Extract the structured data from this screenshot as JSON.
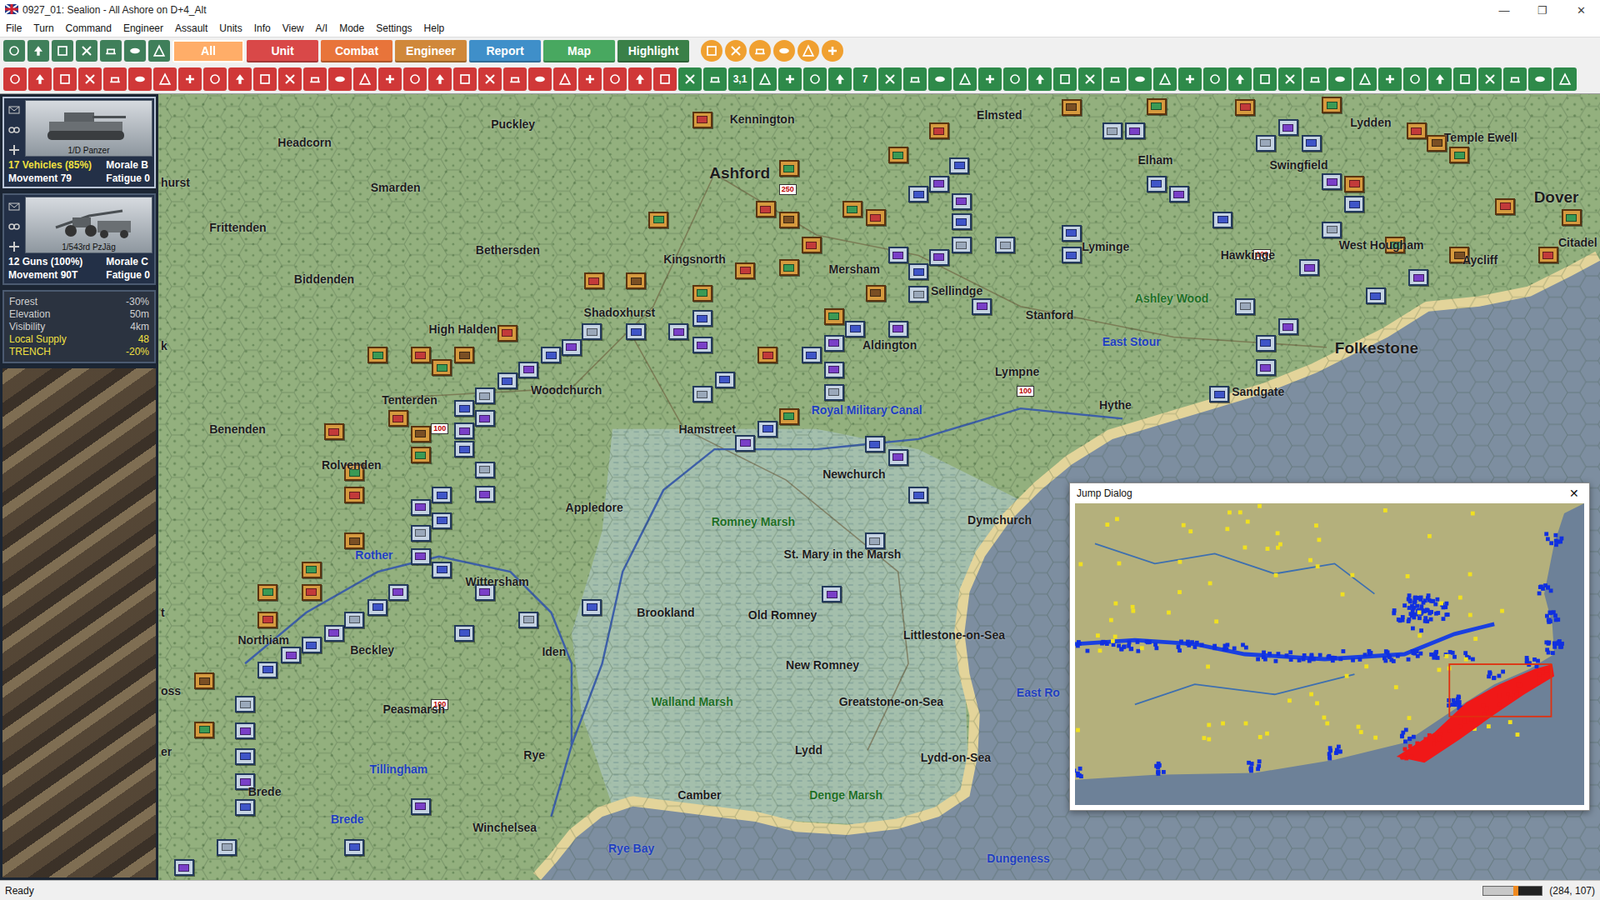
{
  "window": {
    "title": "0927_01: Sealion - All Ashore on D+4_Alt",
    "controls": [
      "—",
      "❐",
      "✕"
    ]
  },
  "menu": [
    "File",
    "Turn",
    "Command",
    "Engineer",
    "Assault",
    "Units",
    "Info",
    "View",
    "A/I",
    "Mode",
    "Settings",
    "Help"
  ],
  "tabs": [
    {
      "label": "All",
      "selected": true,
      "color": "#f0a060"
    },
    {
      "label": "Unit",
      "selected": false,
      "color": "#d94848"
    },
    {
      "label": "Combat",
      "selected": false,
      "color": "#e8743a"
    },
    {
      "label": "Engineer",
      "selected": false,
      "color": "#d0883a"
    },
    {
      "label": "Report",
      "selected": false,
      "color": "#3f8fc9"
    },
    {
      "label": "Map",
      "selected": false,
      "color": "#48a860"
    },
    {
      "label": "Highlight",
      "selected": false,
      "color": "#3a8048"
    }
  ],
  "toolbar2_labels": [
    "3,1",
    "7"
  ],
  "units_panel": [
    {
      "name": "1/D Panzer",
      "strength": "17 Vehicles (85%)",
      "strength_color": "#f0e040",
      "morale": "Morale B",
      "movement": "Movement 79",
      "fatigue": "Fatigue 0",
      "kind": "tank",
      "selected": true
    },
    {
      "name": "1/543rd PzJäg",
      "strength": "12 Guns (100%)",
      "strength_color": "#ffffff",
      "morale": "Morale C",
      "movement": "Movement 90T",
      "fatigue": "Fatigue 0",
      "kind": "gun",
      "selected": false
    }
  ],
  "terrain": [
    {
      "label": "Forest",
      "value": "-30%",
      "highlight": false
    },
    {
      "label": "Elevation",
      "value": "50m",
      "highlight": false
    },
    {
      "label": "Visibility",
      "value": "4km",
      "highlight": false
    },
    {
      "label": "Local Supply",
      "value": "48",
      "highlight": true
    },
    {
      "label": "TRENCH",
      "value": "-20%",
      "highlight": true
    }
  ],
  "map": {
    "places": [
      {
        "name": "Headcorn",
        "kind": "town"
      },
      {
        "name": "Puckley",
        "kind": "town"
      },
      {
        "name": "Kennington",
        "kind": "town"
      },
      {
        "name": "Ashford",
        "kind": "big"
      },
      {
        "name": "Elmsted",
        "kind": "town"
      },
      {
        "name": "Lydden",
        "kind": "town"
      },
      {
        "name": "Temple Ewell",
        "kind": "town"
      },
      {
        "name": "Dover",
        "kind": "big"
      },
      {
        "name": "Elham",
        "kind": "town"
      },
      {
        "name": "Swingfield",
        "kind": "town"
      },
      {
        "name": "Smarden",
        "kind": "town"
      },
      {
        "name": "Frittenden",
        "kind": "town"
      },
      {
        "name": "Bethersden",
        "kind": "town"
      },
      {
        "name": "Kingsnorth",
        "kind": "town"
      },
      {
        "name": "Mersham",
        "kind": "town"
      },
      {
        "name": "Lyminge",
        "kind": "town"
      },
      {
        "name": "Hawkinge",
        "kind": "town"
      },
      {
        "name": "West Hougham",
        "kind": "town"
      },
      {
        "name": "Citadel",
        "kind": "town"
      },
      {
        "name": "Aycliff",
        "kind": "town"
      },
      {
        "name": "Sellindge",
        "kind": "town"
      },
      {
        "name": "Ashley Wood",
        "kind": "region"
      },
      {
        "name": "Biddenden",
        "kind": "town"
      },
      {
        "name": "Shadoxhurst",
        "kind": "town"
      },
      {
        "name": "Aldington",
        "kind": "town"
      },
      {
        "name": "Stanford",
        "kind": "town"
      },
      {
        "name": "East Stour",
        "kind": "water"
      },
      {
        "name": "Folkestone",
        "kind": "big"
      },
      {
        "name": "High Halden",
        "kind": "town"
      },
      {
        "name": "Sandgate",
        "kind": "town"
      },
      {
        "name": "Woodchurch",
        "kind": "town"
      },
      {
        "name": "Lympne",
        "kind": "town"
      },
      {
        "name": "Hythe",
        "kind": "town"
      },
      {
        "name": "Tenterden",
        "kind": "town"
      },
      {
        "name": "Royal Military Canal",
        "kind": "water"
      },
      {
        "name": "Benenden",
        "kind": "town"
      },
      {
        "name": "Hamstreet",
        "kind": "town"
      },
      {
        "name": "Newchurch",
        "kind": "town"
      },
      {
        "name": "Rolvenden",
        "kind": "town"
      },
      {
        "name": "Appledore",
        "kind": "town"
      },
      {
        "name": "Dymchurch",
        "kind": "town"
      },
      {
        "name": "Romney Marsh",
        "kind": "region"
      },
      {
        "name": "Rother",
        "kind": "water"
      },
      {
        "name": "St. Mary in the Marsh",
        "kind": "town"
      },
      {
        "name": "Wittersham",
        "kind": "town"
      },
      {
        "name": "Brookland",
        "kind": "town"
      },
      {
        "name": "Old Romney",
        "kind": "town"
      },
      {
        "name": "Northiam",
        "kind": "town"
      },
      {
        "name": "Littlestone-on-Sea",
        "kind": "town"
      },
      {
        "name": "Beckley",
        "kind": "town"
      },
      {
        "name": "Iden",
        "kind": "town"
      },
      {
        "name": "New Romney",
        "kind": "town"
      },
      {
        "name": "East Ro",
        "kind": "water"
      },
      {
        "name": "Walland Marsh",
        "kind": "region"
      },
      {
        "name": "Greatstone-on-Sea",
        "kind": "town"
      },
      {
        "name": "Peasmarsh",
        "kind": "town"
      },
      {
        "name": "Rye",
        "kind": "town"
      },
      {
        "name": "Lydd",
        "kind": "town"
      },
      {
        "name": "Lydd-on-Sea",
        "kind": "town"
      },
      {
        "name": "Tillingham",
        "kind": "water"
      },
      {
        "name": "Brede",
        "kind": "town"
      },
      {
        "name": "Camber",
        "kind": "town"
      },
      {
        "name": "Denge Marsh",
        "kind": "region"
      },
      {
        "name": "Brede",
        "kind": "water"
      },
      {
        "name": "Winchelsea",
        "kind": "town"
      },
      {
        "name": "Rye Bay",
        "kind": "water"
      },
      {
        "name": "Dungeness",
        "kind": "water"
      },
      {
        "name": "hurst",
        "kind": "town"
      },
      {
        "name": "k",
        "kind": "town"
      },
      {
        "name": "t",
        "kind": "town"
      },
      {
        "name": "oss",
        "kind": "town"
      },
      {
        "name": "er",
        "kind": "town"
      }
    ],
    "markers": [
      {
        "text": "100"
      },
      {
        "text": "100"
      },
      {
        "text": "100"
      },
      {
        "text": "100"
      },
      {
        "text": "250"
      }
    ],
    "units": [
      {
        "side": "axis",
        "color": "#7a3fc8"
      },
      {
        "side": "axis",
        "color": "#3f55c8"
      },
      {
        "side": "axis",
        "color": "#7a3fc8"
      },
      {
        "side": "axis",
        "color": "#3f55c8"
      },
      {
        "side": "axis",
        "color": "#9aa8ba"
      },
      {
        "side": "axis",
        "color": "#7a3fc8"
      },
      {
        "side": "axis",
        "color": "#3f55c8"
      },
      {
        "side": "axis",
        "color": "#7a3fc8"
      },
      {
        "side": "axis",
        "color": "#3f55c8"
      },
      {
        "side": "axis",
        "color": "#9aa8ba"
      },
      {
        "side": "axis",
        "color": "#7a3fc8"
      },
      {
        "side": "axis",
        "color": "#3f55c8"
      },
      {
        "side": "axis",
        "color": "#7a3fc8"
      },
      {
        "side": "axis",
        "color": "#3f55c8"
      },
      {
        "side": "axis",
        "color": "#9aa8ba"
      },
      {
        "side": "axis",
        "color": "#7a3fc8"
      },
      {
        "side": "axis",
        "color": "#3f55c8"
      },
      {
        "side": "axis",
        "color": "#7a3fc8"
      },
      {
        "side": "axis",
        "color": "#3f55c8"
      },
      {
        "side": "axis",
        "color": "#9aa8ba"
      },
      {
        "side": "axis",
        "color": "#7a3fc8"
      },
      {
        "side": "axis",
        "color": "#3f55c8"
      },
      {
        "side": "axis",
        "color": "#7a3fc8"
      },
      {
        "side": "axis",
        "color": "#3f55c8"
      },
      {
        "side": "axis",
        "color": "#9aa8ba"
      },
      {
        "side": "axis",
        "color": "#7a3fc8"
      },
      {
        "side": "axis",
        "color": "#3f55c8"
      },
      {
        "side": "axis",
        "color": "#7a3fc8"
      },
      {
        "side": "axis",
        "color": "#3f55c8"
      },
      {
        "side": "axis",
        "color": "#9aa8ba"
      },
      {
        "side": "axis",
        "color": "#7a3fc8"
      },
      {
        "side": "axis",
        "color": "#3f55c8"
      },
      {
        "side": "axis",
        "color": "#7a3fc8"
      },
      {
        "side": "axis",
        "color": "#3f55c8"
      },
      {
        "side": "axis",
        "color": "#9aa8ba"
      },
      {
        "side": "axis",
        "color": "#7a3fc8"
      },
      {
        "side": "axis",
        "color": "#3f55c8"
      },
      {
        "side": "axis",
        "color": "#7a3fc8"
      },
      {
        "side": "axis",
        "color": "#3f55c8"
      },
      {
        "side": "axis",
        "color": "#9aa8ba"
      },
      {
        "side": "axis",
        "color": "#7a3fc8"
      },
      {
        "side": "axis",
        "color": "#3f55c8"
      },
      {
        "side": "axis",
        "color": "#7a3fc8"
      },
      {
        "side": "axis",
        "color": "#3f55c8"
      },
      {
        "side": "axis",
        "color": "#9aa8ba"
      },
      {
        "side": "axis",
        "color": "#7a3fc8"
      },
      {
        "side": "axis",
        "color": "#3f55c8"
      },
      {
        "side": "axis",
        "color": "#7a3fc8"
      },
      {
        "side": "axis",
        "color": "#3f55c8"
      },
      {
        "side": "axis",
        "color": "#9aa8ba"
      },
      {
        "side": "axis",
        "color": "#7a3fc8"
      },
      {
        "side": "axis",
        "color": "#3f55c8"
      },
      {
        "side": "axis",
        "color": "#7a3fc8"
      },
      {
        "side": "axis",
        "color": "#3f55c8"
      },
      {
        "side": "axis",
        "color": "#9aa8ba"
      },
      {
        "side": "axis",
        "color": "#7a3fc8"
      },
      {
        "side": "axis",
        "color": "#3f55c8"
      },
      {
        "side": "axis",
        "color": "#7a3fc8"
      },
      {
        "side": "axis",
        "color": "#3f55c8"
      },
      {
        "side": "axis",
        "color": "#9aa8ba"
      },
      {
        "side": "axis",
        "color": "#7a3fc8"
      },
      {
        "side": "axis",
        "color": "#3f55c8"
      },
      {
        "side": "axis",
        "color": "#7a3fc8"
      },
      {
        "side": "axis",
        "color": "#3f55c8"
      },
      {
        "side": "axis",
        "color": "#9aa8ba"
      },
      {
        "side": "axis",
        "color": "#7a3fc8"
      },
      {
        "side": "axis",
        "color": "#3f55c8"
      },
      {
        "side": "axis",
        "color": "#7a3fc8"
      },
      {
        "side": "axis",
        "color": "#3f55c8"
      },
      {
        "side": "axis",
        "color": "#9aa8ba"
      },
      {
        "side": "axis",
        "color": "#7a3fc8"
      },
      {
        "side": "axis",
        "color": "#3f55c8"
      },
      {
        "side": "axis",
        "color": "#7a3fc8"
      },
      {
        "side": "axis",
        "color": "#3f55c8"
      },
      {
        "side": "axis",
        "color": "#9aa8ba"
      },
      {
        "side": "axis",
        "color": "#7a3fc8"
      },
      {
        "side": "axis",
        "color": "#3f55c8"
      },
      {
        "side": "axis",
        "color": "#7a3fc8"
      },
      {
        "side": "axis",
        "color": "#3f55c8"
      },
      {
        "side": "axis",
        "color": "#9aa8ba"
      },
      {
        "side": "axis",
        "color": "#7a3fc8"
      },
      {
        "side": "axis",
        "color": "#3f55c8"
      },
      {
        "side": "axis",
        "color": "#7a3fc8"
      },
      {
        "side": "axis",
        "color": "#3f55c8"
      },
      {
        "side": "axis",
        "color": "#9aa8ba"
      },
      {
        "side": "axis",
        "color": "#7a3fc8"
      },
      {
        "side": "axis",
        "color": "#3f55c8"
      },
      {
        "side": "axis",
        "color": "#7a3fc8"
      },
      {
        "side": "axis",
        "color": "#3f55c8"
      },
      {
        "side": "axis",
        "color": "#9aa8ba"
      },
      {
        "side": "allied",
        "color": "#c23a3a"
      },
      {
        "side": "allied",
        "color": "#3a9a55"
      },
      {
        "side": "allied",
        "color": "#c23a3a"
      },
      {
        "side": "allied",
        "color": "#7a4f24"
      },
      {
        "side": "allied",
        "color": "#3a9a55"
      },
      {
        "side": "allied",
        "color": "#c23a3a"
      },
      {
        "side": "allied",
        "color": "#3a9a55"
      },
      {
        "side": "allied",
        "color": "#c23a3a"
      },
      {
        "side": "allied",
        "color": "#7a4f24"
      },
      {
        "side": "allied",
        "color": "#3a9a55"
      },
      {
        "side": "allied",
        "color": "#c23a3a"
      },
      {
        "side": "allied",
        "color": "#3a9a55"
      },
      {
        "side": "allied",
        "color": "#c23a3a"
      },
      {
        "side": "allied",
        "color": "#7a4f24"
      },
      {
        "side": "allied",
        "color": "#3a9a55"
      },
      {
        "side": "allied",
        "color": "#c23a3a"
      },
      {
        "side": "allied",
        "color": "#3a9a55"
      },
      {
        "side": "allied",
        "color": "#c23a3a"
      },
      {
        "side": "allied",
        "color": "#7a4f24"
      },
      {
        "side": "allied",
        "color": "#3a9a55"
      },
      {
        "side": "allied",
        "color": "#c23a3a"
      },
      {
        "side": "allied",
        "color": "#3a9a55"
      },
      {
        "side": "allied",
        "color": "#c23a3a"
      },
      {
        "side": "allied",
        "color": "#7a4f24"
      },
      {
        "side": "allied",
        "color": "#3a9a55"
      },
      {
        "side": "allied",
        "color": "#c23a3a"
      },
      {
        "side": "allied",
        "color": "#3a9a55"
      },
      {
        "side": "allied",
        "color": "#c23a3a"
      },
      {
        "side": "allied",
        "color": "#7a4f24"
      },
      {
        "side": "allied",
        "color": "#3a9a55"
      },
      {
        "side": "allied",
        "color": "#c23a3a"
      },
      {
        "side": "allied",
        "color": "#3a9a55"
      },
      {
        "side": "allied",
        "color": "#c23a3a"
      },
      {
        "side": "allied",
        "color": "#7a4f24"
      },
      {
        "side": "allied",
        "color": "#3a9a55"
      },
      {
        "side": "allied",
        "color": "#c23a3a"
      },
      {
        "side": "allied",
        "color": "#3a9a55"
      },
      {
        "side": "allied",
        "color": "#c23a3a"
      },
      {
        "side": "allied",
        "color": "#7a4f24"
      },
      {
        "side": "allied",
        "color": "#3a9a55"
      },
      {
        "side": "allied",
        "color": "#c23a3a"
      },
      {
        "side": "allied",
        "color": "#3a9a55"
      },
      {
        "side": "allied",
        "color": "#c23a3a"
      },
      {
        "side": "allied",
        "color": "#7a4f24"
      },
      {
        "side": "allied",
        "color": "#3a9a55"
      },
      {
        "side": "allied",
        "color": "#c23a3a"
      },
      {
        "side": "allied",
        "color": "#3a9a55"
      },
      {
        "side": "allied",
        "color": "#c23a3a"
      },
      {
        "side": "allied",
        "color": "#7a4f24"
      },
      {
        "side": "allied",
        "color": "#3a9a55"
      }
    ]
  },
  "jump_dialog": {
    "title": "Jump Dialog",
    "close": "✕"
  },
  "status_bar": {
    "text": "Ready",
    "coords": "(284, 107)",
    "level": 0.55
  }
}
